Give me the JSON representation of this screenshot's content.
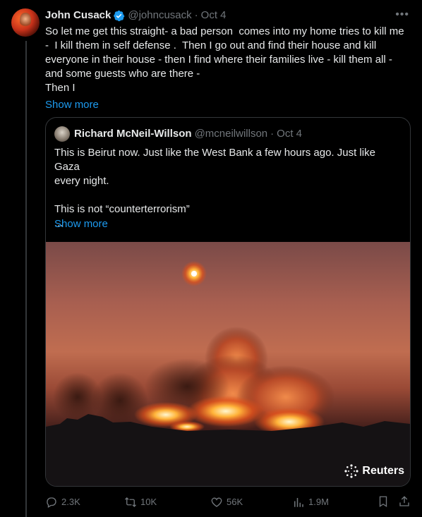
{
  "tweet": {
    "author_name": "John Cusack",
    "author_handle": "@johncusack",
    "date": "Oct 4",
    "text": "So let me get this straight- a bad person  comes into my home tries to kill me\n-  I kill them in self defense .  Then I go out and find their house and kill\neveryone in their house - then I find where their families live - kill them all -\nand some guests who are there -\nThen I",
    "show_more": "Show more"
  },
  "quote": {
    "author_name": "Richard McNeil-Willson",
    "author_handle": "@mcneilwillson",
    "date": "Oct 4",
    "text": "This is Beirut now. Just like the West Bank a few hours ago. Just like Gaza\nevery night.\n\nThis is not “counterterrorism”\n...",
    "show_more": "Show more",
    "image_watermark": "Reuters"
  },
  "actions": {
    "replies": "2.3K",
    "reposts": "10K",
    "likes": "56K",
    "views": "1.9M"
  },
  "icons": [
    "verified-badge-icon",
    "more-icon",
    "reply-icon",
    "repost-icon",
    "like-icon",
    "views-icon",
    "bookmark-icon",
    "share-icon"
  ],
  "colors": {
    "accent": "#1d9bf0",
    "muted": "#71767b",
    "text": "#e7e9ea",
    "background": "#000000",
    "border": "#333639"
  }
}
